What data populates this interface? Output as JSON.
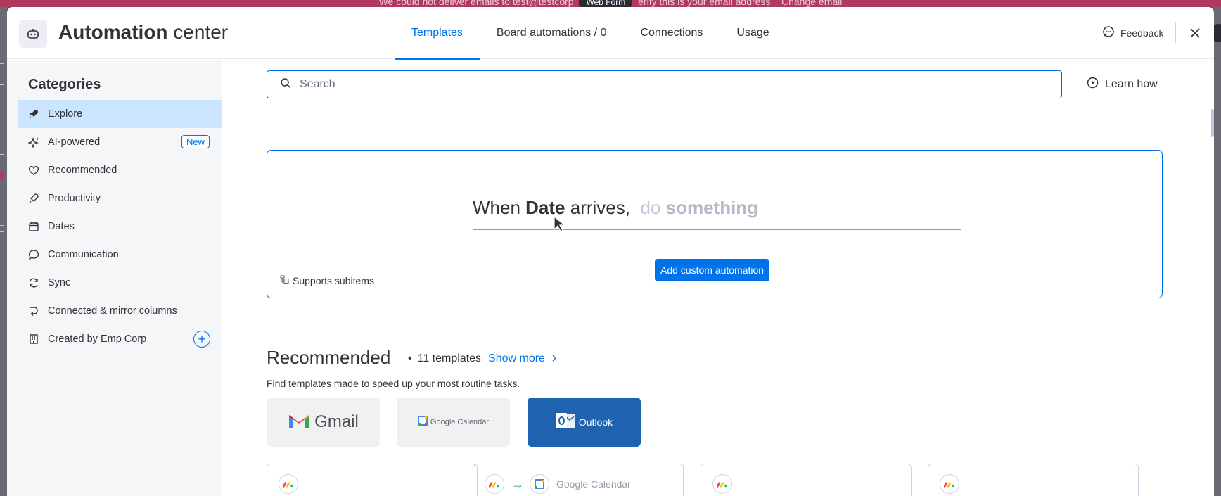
{
  "background": {
    "banner_text_before": "We could not deliver emails to test@testcorp",
    "banner_pill": "Web Form",
    "banner_text_after": "erify this is your email address",
    "banner_link": "Change email",
    "banner_color": "#b0395f"
  },
  "header": {
    "title_bold": "Automation",
    "title_rest": " center",
    "logo_icon": "robot-icon",
    "tabs": [
      {
        "label": "Templates",
        "active": true
      },
      {
        "label": "Board automations / 0",
        "active": false
      },
      {
        "label": "Connections",
        "active": false
      },
      {
        "label": "Usage",
        "active": false
      }
    ],
    "feedback_label": "Feedback",
    "close_icon": "close-icon"
  },
  "sidebar": {
    "title": "Categories",
    "items": [
      {
        "label": "Explore",
        "icon": "rocket-icon",
        "active": true
      },
      {
        "label": "AI-powered",
        "icon": "sparkle-icon",
        "badge": "New"
      },
      {
        "label": "Recommended",
        "icon": "heart-icon"
      },
      {
        "label": "Productivity",
        "icon": "rocket-outline-icon"
      },
      {
        "label": "Dates",
        "icon": "calendar-icon"
      },
      {
        "label": "Communication",
        "icon": "chat-icon"
      },
      {
        "label": "Sync",
        "icon": "sync-icon"
      },
      {
        "label": "Connected & mirror columns",
        "icon": "connect-icon"
      },
      {
        "label": "Created by Emp Corp",
        "icon": "building-icon"
      }
    ]
  },
  "search": {
    "placeholder": "Search",
    "value": ""
  },
  "learn_how_label": "Learn how",
  "custom_automation": {
    "when": "When",
    "trigger": "Date",
    "arrives": "arrives,",
    "do": "do",
    "something": "something",
    "button_label": "Add custom automation",
    "supports_label": "Supports subitems"
  },
  "recommended": {
    "title": "Recommended",
    "bullet": "•",
    "count_label": "11 templates",
    "show_more_label": "Show more",
    "subtitle": "Find templates made to speed up your most routine tasks.",
    "apps": [
      {
        "label": "Gmail"
      },
      {
        "label": "Google Calendar"
      },
      {
        "label": "Outlook"
      }
    ],
    "template_cards": [
      {
        "integration": ""
      },
      {
        "integration": "Google Calendar"
      },
      {
        "integration": ""
      },
      {
        "integration": ""
      }
    ]
  },
  "colors": {
    "accent": "#0073ea",
    "sidebar_active": "#cce5ff",
    "outlook_blue": "#1e62b0"
  }
}
